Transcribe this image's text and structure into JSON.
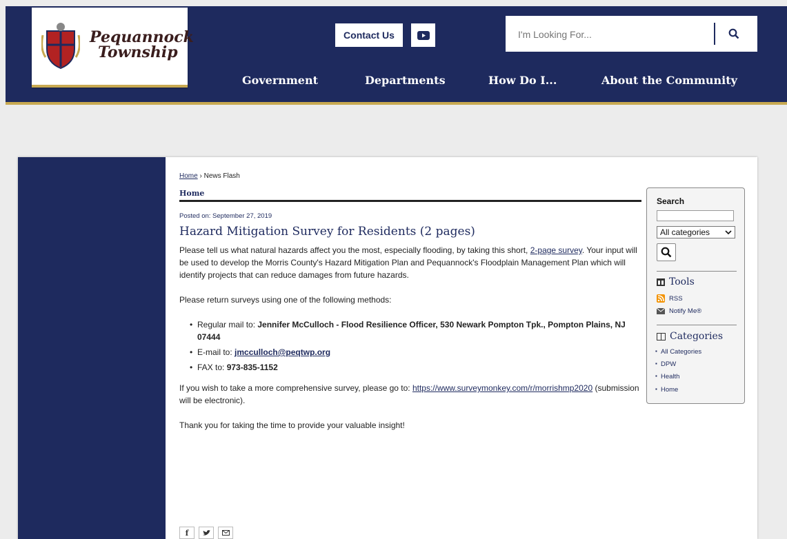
{
  "header": {
    "logo_line1": "Pequannock",
    "logo_line2": "Township",
    "contact_label": "Contact Us",
    "search_placeholder": "I'm Looking For...",
    "nav": [
      "Government",
      "Departments",
      "How Do I...",
      "About the Community"
    ]
  },
  "breadcrumb": {
    "home": "Home",
    "sep": "›",
    "current": "News Flash"
  },
  "section_heading": "Home",
  "article": {
    "posted": "Posted on: September 27, 2019",
    "title": "Hazard Mitigation Survey for Residents (2 pages)",
    "intro_before": "Please tell us what natural hazards affect you the most, especially flooding, by taking this short, ",
    "intro_link": "2-page survey",
    "intro_after": ".  Your input will be used to develop the Morris County's Hazard Mitigation Plan and Pequannock's Floodplain Management Plan which will identify projects that can reduce damages from future hazards.",
    "methods_intro": "Please return surveys using one of the following methods:",
    "mail_label": "Regular mail to: ",
    "mail_value": "Jennifer McCulloch - Flood Resilience Officer, 530 Newark Pompton Tpk., Pompton Plains, NJ 07444",
    "email_label": "E-mail to: ",
    "email_value": "jmcculloch@peqtwp.org",
    "fax_label": "FAX to: ",
    "fax_value": "973-835-1152",
    "more_before": "If you wish to take a more comprehensive survey, please go to: ",
    "more_link": "https://www.surveymonkey.com/r/morrishmp2020",
    "more_after": " (submission will be electronic).",
    "thanks": "Thank you for taking the time to provide your valuable insight!"
  },
  "sidebar": {
    "search_label": "Search",
    "category_selected": "All categories",
    "tools_heading": "Tools",
    "rss": "RSS",
    "notify": "Notify Me®",
    "categories_heading": "Categories",
    "categories": [
      "All Categories",
      "DPW",
      "Health",
      "Home"
    ]
  },
  "colors": {
    "navy": "#1e2a5e",
    "gold": "#c8a951"
  }
}
